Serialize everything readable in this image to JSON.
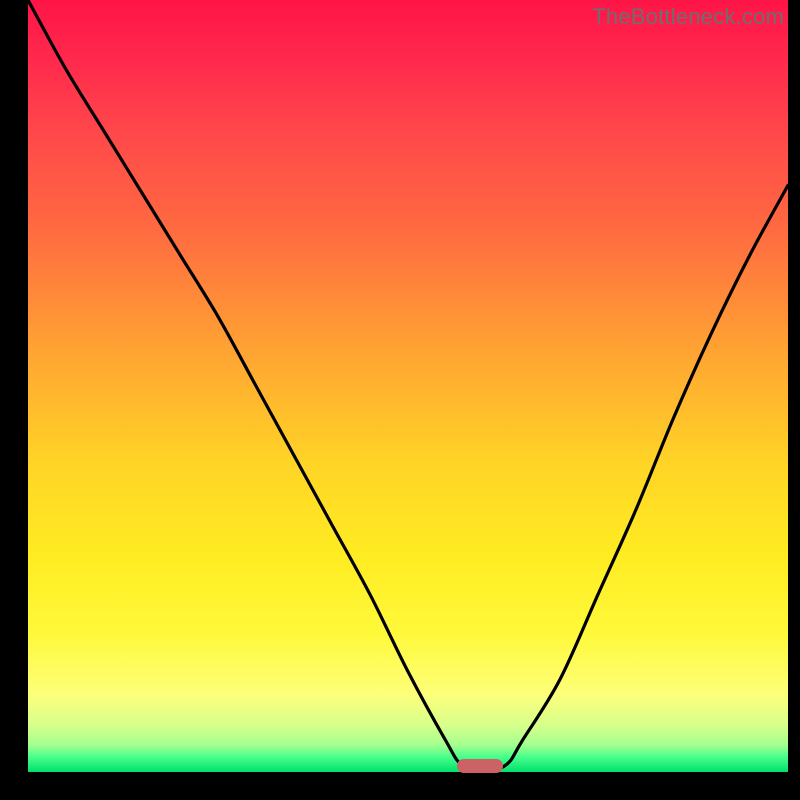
{
  "watermark": "TheBottleneck.com",
  "marker": {
    "x_pct": 59.5,
    "y_pct": 99.2
  },
  "chart_data": {
    "type": "line",
    "title": "",
    "xlabel": "",
    "ylabel": "",
    "xlim": [
      0,
      100
    ],
    "ylim": [
      0,
      100
    ],
    "grid": false,
    "legend": false,
    "annotations": [
      "TheBottleneck.com"
    ],
    "background_gradient_top": "#ff1447",
    "background_gradient_bottom": "#00e06b",
    "description": "V-shaped bottleneck curve on red-to-green heat gradient; minimum marked by small rounded bar",
    "series": [
      {
        "name": "bottleneck-curve",
        "color": "#000000",
        "x": [
          0,
          5,
          10,
          15,
          20,
          25,
          30,
          35,
          40,
          45,
          50,
          55,
          57,
          60,
          63,
          65,
          70,
          75,
          80,
          85,
          90,
          95,
          100
        ],
        "y": [
          100,
          91,
          83,
          75,
          67,
          59,
          50,
          41,
          32,
          23,
          13,
          4,
          1,
          0,
          1,
          4,
          12,
          23,
          34,
          46,
          57,
          67,
          76
        ]
      }
    ],
    "marker_point": {
      "x": 60,
      "y": 0
    }
  }
}
